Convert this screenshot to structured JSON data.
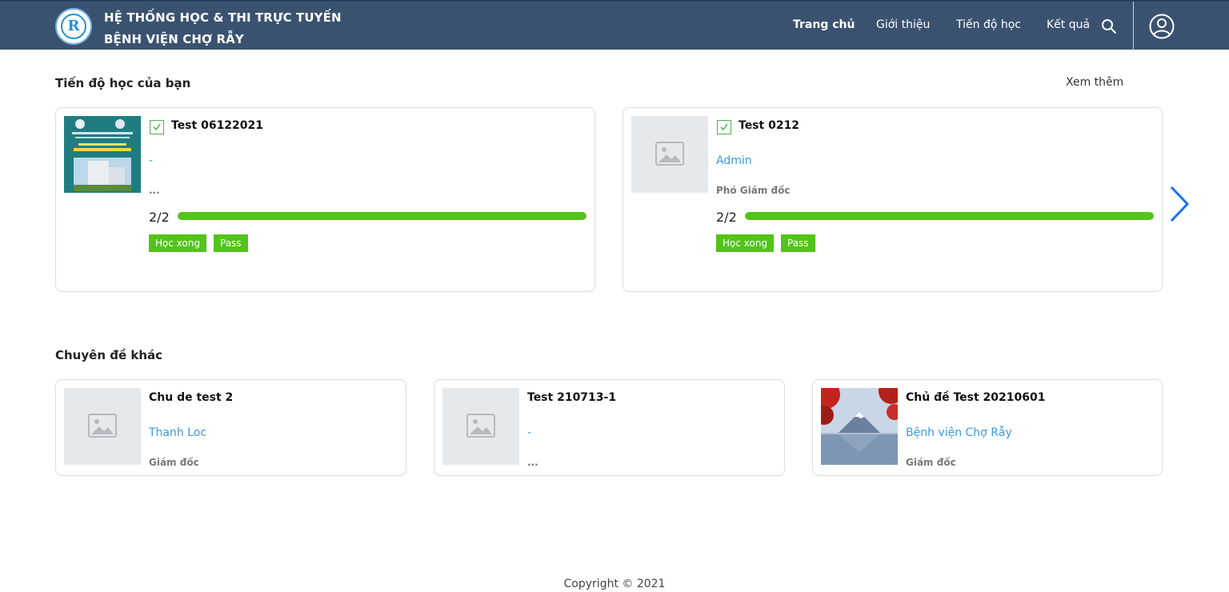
{
  "header": {
    "brand_line1": "HỆ THỐNG HỌC & THI TRỰC TUYẾN",
    "brand_line2": "BỆNH VIỆN CHỢ RẪY",
    "logo_letter": "R",
    "nav": {
      "home": "Trang chủ",
      "about": "Giới thiệu",
      "progress": "Tiến độ học",
      "results": "Kết quả"
    }
  },
  "progress_section": {
    "title": "Tiến độ học của bạn",
    "see_more": "Xem thêm",
    "cards": [
      {
        "title": "Test 06122021",
        "author": "-",
        "role": "...",
        "progress_text": "2/2",
        "progress_fraction": 1.0,
        "badge_status": "Học xong",
        "badge_result": "Pass",
        "thumb_kind": "poster"
      },
      {
        "title": "Test 0212",
        "author": "Admin",
        "role": "Phó Giám đốc",
        "progress_text": "2/2",
        "progress_fraction": 1.0,
        "badge_status": "Học xong",
        "badge_result": "Pass",
        "thumb_kind": "placeholder"
      }
    ]
  },
  "other_section": {
    "title": "Chuyên đề khác",
    "cards": [
      {
        "title": "Chu de test 2",
        "author": "Thanh Loc",
        "role": "Giám đốc",
        "thumb_kind": "placeholder"
      },
      {
        "title": "Test 210713-1",
        "author": "-",
        "role": "...",
        "thumb_kind": "placeholder"
      },
      {
        "title": "Chủ đề Test 20210601",
        "author": "Bệnh viện Chợ Rẫy",
        "role": "Giám đốc",
        "thumb_kind": "landscape"
      }
    ]
  },
  "footer": {
    "copyright": "Copyright © 2021"
  },
  "colors": {
    "header_bg": "#3a5270",
    "accent_green": "#52c41a",
    "link_blue": "#3b9ae1"
  }
}
